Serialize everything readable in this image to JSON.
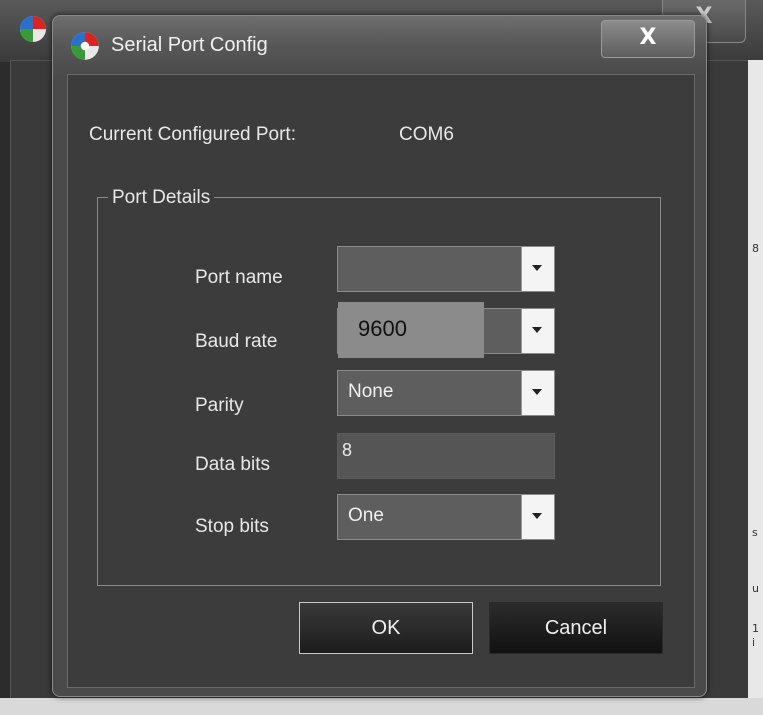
{
  "dialog": {
    "title": "Serial Port Config",
    "close_label": "X"
  },
  "current_port": {
    "label": "Current Configured Port:",
    "value": "COM6"
  },
  "port_details": {
    "group_label": "Port Details",
    "fields": [
      {
        "label": "Port name",
        "value": "",
        "type": "combo"
      },
      {
        "label": "Baud rate",
        "value": "9600",
        "type": "combo"
      },
      {
        "label": "Parity",
        "value": "None",
        "type": "combo"
      },
      {
        "label": "Data bits",
        "value": "8",
        "type": "text"
      },
      {
        "label": "Stop bits",
        "value": "One",
        "type": "combo"
      }
    ]
  },
  "buttons": {
    "ok": "OK",
    "cancel": "Cancel"
  },
  "background_window": {
    "close_label": "X",
    "edge_glyphs": [
      "8",
      "s",
      "u",
      "1",
      "i"
    ]
  },
  "colors": {
    "dialog_bg": "#3c3c3c",
    "text": "#e8e8e8",
    "combo_bg": "#5e5e5e"
  }
}
